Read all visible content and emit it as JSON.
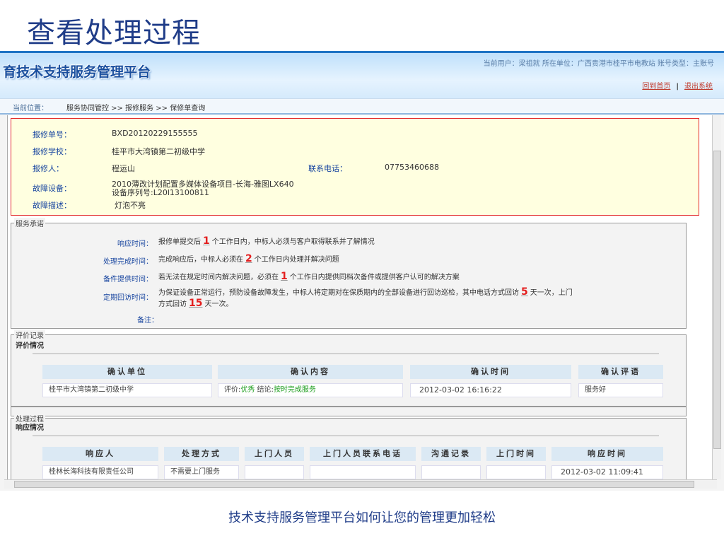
{
  "slide": {
    "title": "查看处理过程",
    "caption": "技术支持服务管理平台如何让您的管理更加轻松"
  },
  "header": {
    "logo": "育技术支持服务管理平台",
    "user_info": "当前用户：梁祖就   所在单位：广西贵港市桂平市电教站   账号类型：主账号",
    "home_link": "回到首页",
    "logout_link": "退出系统"
  },
  "breadcrumb": {
    "label": "当前位置：",
    "path": "服务协同管控 >> 报修服务 >> 保修单查询"
  },
  "repair_info": {
    "order_no_label": "报修单号：",
    "order_no": "BXD20120229155555",
    "school_label": "报修学校：",
    "school": "桂平市大湾镇第二初级中学",
    "reporter_label": "报修人：",
    "reporter": "程运山",
    "phone_label": "联系电话：",
    "phone": "07753460688",
    "device_label": "故障设备：",
    "device_line1": "2010薄改计划配置多媒体设备项目-长海-雅图LX640",
    "device_line2": "设备序列号:L20l13100811",
    "desc_label": "故障描述：",
    "desc": "灯泡不亮"
  },
  "service_commitment": {
    "legend": "服务承诺",
    "response_label": "响应时间：",
    "response_pre": "报修单提交后",
    "response_num": "1",
    "response_post": "个工作日内，中标人必须与客户取得联系并了解情况",
    "complete_label": "处理完成时间：",
    "complete_pre": "完成响应后，中标人必须在",
    "complete_num": "2",
    "complete_post": "个工作日内处理并解决问题",
    "spare_label": "备件提供时间：",
    "spare_pre": "若无法在规定时间内解决问题，必须在",
    "spare_num": "1",
    "spare_post": "个工作日内提供同档次备件或提供客户认可的解决方案",
    "revisit_label": "定期回访时间：",
    "revisit_pre": "为保证设备正常运行，预防设备故障发生，中标人将定期对在保质期内的全部设备进行回访巡检，其中电话方式回访",
    "revisit_num1": "5",
    "revisit_mid": "天一次，上门",
    "revisit_line2_pre": "方式回访",
    "revisit_num2": "15",
    "revisit_post": "天一次。",
    "remark_label": "备注："
  },
  "evaluation": {
    "legend": "评价记录",
    "subtitle": "评价情况",
    "columns": [
      "确认单位",
      "确认内容",
      "确认时间",
      "确认评语"
    ],
    "row": {
      "unit": "桂平市大湾镇第二初级中学",
      "content_pre": "评价:",
      "content_rating": "优秀",
      "content_mid": " 结论:",
      "content_result": "按时完成服务",
      "time": "2012-03-02 16:16:22",
      "comment": "服务好"
    }
  },
  "process": {
    "legend": "处理过程",
    "subtitle": "响应情况",
    "columns": [
      "响应人",
      "处理方式",
      "上门人员",
      "上门人员联系电话",
      "沟通记录",
      "上门时间",
      "响应时间"
    ],
    "row": {
      "responder": "桂林长海科技有限责任公司",
      "method": "不需要上门服务",
      "visitor": "",
      "visitor_phone": "",
      "record": "",
      "visit_time": "",
      "response_time": "2012-03-02 11:09:41"
    }
  },
  "colors": {
    "accent": "#1a47a0",
    "highlight": "#e31e1e",
    "positive": "#1e9e1e"
  }
}
